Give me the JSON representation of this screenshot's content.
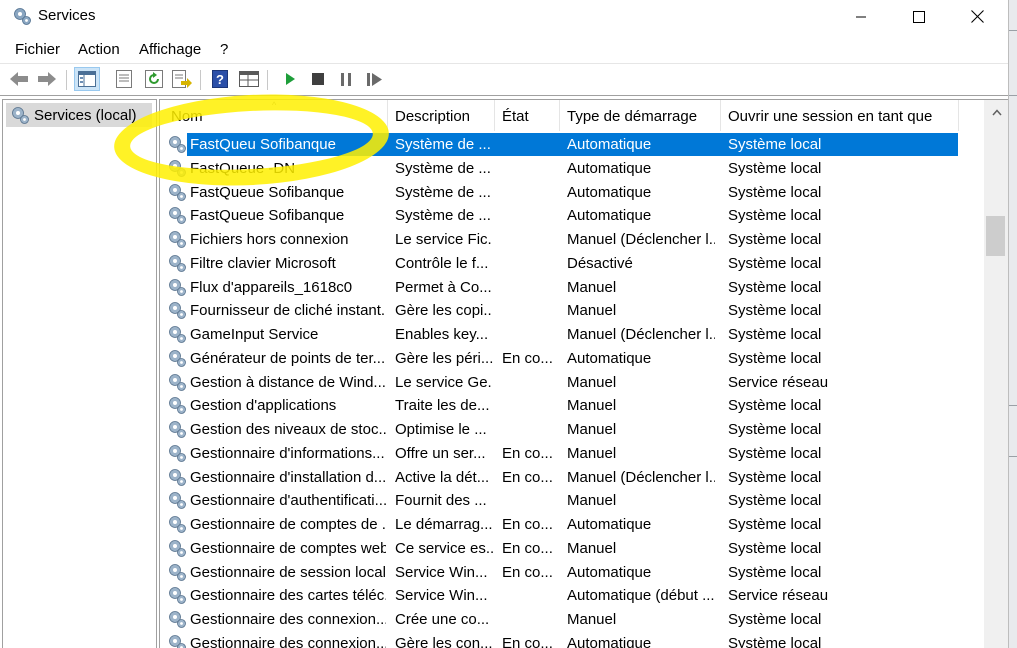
{
  "window": {
    "title": "Services",
    "app_icon": "services-gear-icon",
    "controls": [
      "minimize-icon",
      "maximize-icon",
      "close-icon"
    ]
  },
  "menu": {
    "file": "Fichier",
    "action": "Action",
    "view": "Affichage",
    "help": "?"
  },
  "toolbar": {
    "buttons": [
      "back-arrow-icon",
      "forward-arrow-icon",
      "show-hide-tree-icon",
      "properties-icon",
      "refresh-icon",
      "export-list-icon",
      "help-icon",
      "console-view-icon",
      "start-service-icon",
      "stop-service-icon",
      "pause-service-icon",
      "restart-service-icon"
    ]
  },
  "tree": {
    "root_label": "Services (local)"
  },
  "columns": {
    "name": "Nom",
    "description": "Description",
    "state": "État",
    "startup": "Type de démarrage",
    "logon": "Ouvrir une session en tant que"
  },
  "rows": [
    {
      "name": "FastQueu Sofibanque",
      "desc": "Système de ...",
      "state": "",
      "startup": "Automatique",
      "logon": "Système local",
      "selected": true
    },
    {
      "name": "FastQueue -DN",
      "desc": "Système de ...",
      "state": "",
      "startup": "Automatique",
      "logon": "Système local"
    },
    {
      "name": "FastQueue Sofibanque",
      "desc": "Système de ...",
      "state": "",
      "startup": "Automatique",
      "logon": "Système local"
    },
    {
      "name": "FastQueue Sofibanque",
      "desc": "Système de ...",
      "state": "",
      "startup": "Automatique",
      "logon": "Système local"
    },
    {
      "name": "Fichiers hors connexion",
      "desc": "Le service Fic...",
      "state": "",
      "startup": "Manuel (Déclencher l...",
      "logon": "Système local"
    },
    {
      "name": "Filtre clavier Microsoft",
      "desc": "Contrôle le f...",
      "state": "",
      "startup": "Désactivé",
      "logon": "Système local"
    },
    {
      "name": "Flux d'appareils_1618c0",
      "desc": "Permet à Co...",
      "state": "",
      "startup": "Manuel",
      "logon": "Système local"
    },
    {
      "name": "Fournisseur de cliché instant...",
      "desc": "Gère les copi...",
      "state": "",
      "startup": "Manuel",
      "logon": "Système local"
    },
    {
      "name": "GameInput Service",
      "desc": "Enables key...",
      "state": "",
      "startup": "Manuel (Déclencher l...",
      "logon": "Système local"
    },
    {
      "name": "Générateur de points de ter...",
      "desc": "Gère les péri...",
      "state": "En co...",
      "startup": "Automatique",
      "logon": "Système local"
    },
    {
      "name": "Gestion à distance de Wind...",
      "desc": "Le service Ge...",
      "state": "",
      "startup": "Manuel",
      "logon": "Service réseau"
    },
    {
      "name": "Gestion d'applications",
      "desc": "Traite les de...",
      "state": "",
      "startup": "Manuel",
      "logon": "Système local"
    },
    {
      "name": "Gestion des niveaux de stoc...",
      "desc": "Optimise le ...",
      "state": "",
      "startup": "Manuel",
      "logon": "Système local"
    },
    {
      "name": "Gestionnaire d'informations...",
      "desc": "Offre un ser...",
      "state": "En co...",
      "startup": "Manuel",
      "logon": "Système local"
    },
    {
      "name": "Gestionnaire d'installation d...",
      "desc": "Active la dét...",
      "state": "En co...",
      "startup": "Manuel (Déclencher l...",
      "logon": "Système local"
    },
    {
      "name": "Gestionnaire d'authentificati...",
      "desc": "Fournit des ...",
      "state": "",
      "startup": "Manuel",
      "logon": "Système local"
    },
    {
      "name": "Gestionnaire de comptes de ...",
      "desc": "Le démarrag...",
      "state": "En co...",
      "startup": "Automatique",
      "logon": "Système local"
    },
    {
      "name": "Gestionnaire de comptes web",
      "desc": "Ce service es...",
      "state": "En co...",
      "startup": "Manuel",
      "logon": "Système local"
    },
    {
      "name": "Gestionnaire de session locale",
      "desc": "Service Win...",
      "state": "En co...",
      "startup": "Automatique",
      "logon": "Système local"
    },
    {
      "name": "Gestionnaire des cartes téléc...",
      "desc": "Service Win...",
      "state": "",
      "startup": "Automatique (début ...",
      "logon": "Service réseau"
    },
    {
      "name": "Gestionnaire des connexion...",
      "desc": "Crée une co...",
      "state": "",
      "startup": "Manuel",
      "logon": "Système local"
    },
    {
      "name": "Gestionnaire des connexion...",
      "desc": "Gère les con...",
      "state": "En co...",
      "startup": "Automatique",
      "logon": "Système local"
    }
  ],
  "colors": {
    "selection": "#0078d7",
    "highlight_annotation": "#fff000"
  }
}
